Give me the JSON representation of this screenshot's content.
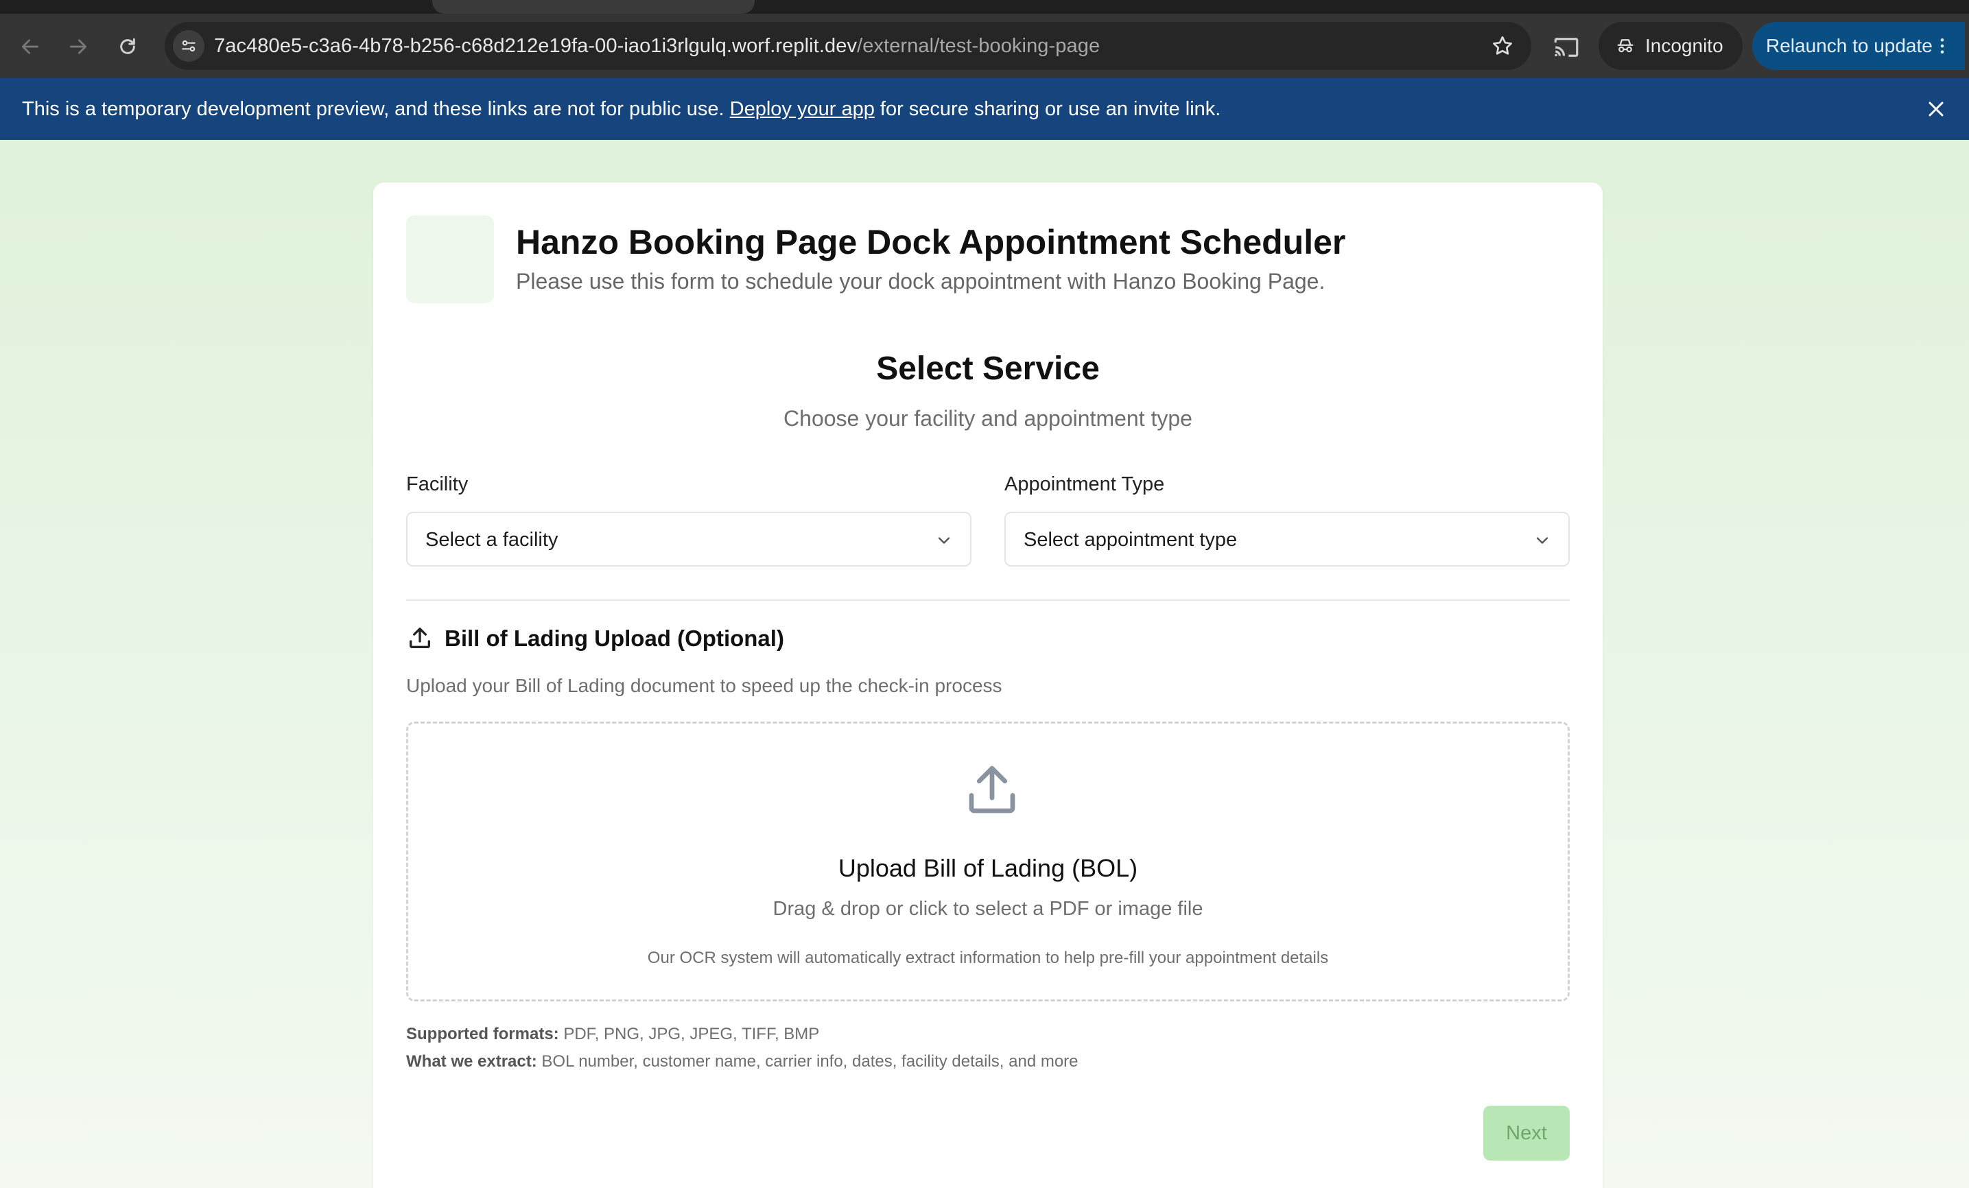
{
  "browser": {
    "url_host": "7ac480e5-c3a6-4b78-b256-c68d212e19fa-00-iao1i3rlgulq.worf.replit.dev",
    "url_path": "/external/test-booking-page",
    "incognito_label": "Incognito",
    "relaunch_label": "Relaunch to update"
  },
  "banner": {
    "text_before": "This is a temporary development preview, and these links are not for public use. ",
    "link": "Deploy your app",
    "text_after": " for secure sharing or use an invite link."
  },
  "header": {
    "title": "Hanzo Booking Page Dock Appointment Scheduler",
    "subtitle": "Please use this form to schedule your dock appointment with Hanzo Booking Page."
  },
  "service": {
    "title": "Select Service",
    "subtitle": "Choose your facility and appointment type",
    "facility_label": "Facility",
    "facility_value": "Select a facility",
    "appointment_label": "Appointment Type",
    "appointment_value": "Select appointment type"
  },
  "bol": {
    "title": "Bill of Lading Upload (Optional)",
    "description": "Upload your Bill of Lading document to speed up the check-in process",
    "dropzone_title": "Upload Bill of Lading (BOL)",
    "dropzone_desc": "Drag & drop or click to select a PDF or image file",
    "dropzone_note": "Our OCR system will automatically extract information to help pre-fill your appointment details",
    "formats_label": "Supported formats:",
    "formats_value": " PDF, PNG, JPG, JPEG, TIFF, BMP",
    "extract_label": "What we extract:",
    "extract_value": " BOL number, customer name, carrier info, dates, facility details, and more"
  },
  "actions": {
    "next_label": "Next"
  },
  "colors": {
    "banner_bg": "#16447d",
    "relaunch_bg": "#0a4f84",
    "next_bg": "#b8e6b5",
    "page_bg": "#e0f2db"
  },
  "icons": [
    "back-arrow-icon",
    "forward-arrow-icon",
    "reload-icon",
    "site-info-icon",
    "star-icon",
    "cast-icon",
    "incognito-icon",
    "more-vert-icon",
    "close-icon",
    "chevron-down-icon",
    "upload-icon"
  ]
}
